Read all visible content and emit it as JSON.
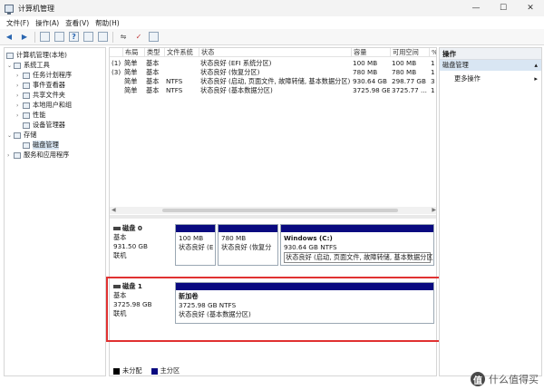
{
  "window": {
    "title": "计算机管理",
    "controls": [
      "—",
      "☐",
      "✕"
    ]
  },
  "menu": [
    "文件(F)",
    "操作(A)",
    "查看(V)",
    "帮助(H)"
  ],
  "tree": {
    "root": "计算机管理(本地)",
    "items": [
      {
        "label": "系统工具",
        "level": 1,
        "expanded": true
      },
      {
        "label": "任务计划程序",
        "level": 2
      },
      {
        "label": "事件查看器",
        "level": 2
      },
      {
        "label": "共享文件夹",
        "level": 2
      },
      {
        "label": "本地用户和组",
        "level": 2
      },
      {
        "label": "性能",
        "level": 2
      },
      {
        "label": "设备管理器",
        "level": 2
      },
      {
        "label": "存储",
        "level": 1,
        "expanded": true
      },
      {
        "label": "磁盘管理",
        "level": 2,
        "selected": true
      },
      {
        "label": "服务和应用程序",
        "level": 1
      }
    ]
  },
  "volumes": {
    "columns": [
      "布局",
      "类型",
      "文件系统",
      "状态",
      "容量",
      "可用空间",
      "%"
    ],
    "rows": [
      {
        "vol": "(1)",
        "layout": "简单",
        "type": "基本",
        "fs": "",
        "status": "状态良好 (EFI 系统分区)",
        "capacity": "100 MB",
        "free": "100 MB",
        "pct": "1"
      },
      {
        "vol": "(3)",
        "layout": "简单",
        "type": "基本",
        "fs": "",
        "status": "状态良好 (恢复分区)",
        "capacity": "780 MB",
        "free": "780 MB",
        "pct": "1"
      },
      {
        "vol": "",
        "layout": "简单",
        "type": "基本",
        "fs": "NTFS",
        "status": "状态良好 (启动, 页面文件, 故障转储, 基本数据分区)",
        "capacity": "930.64 GB",
        "free": "298.77 GB",
        "pct": "3"
      },
      {
        "vol": "",
        "layout": "简单",
        "type": "基本",
        "fs": "NTFS",
        "status": "状态良好 (基本数据分区)",
        "capacity": "3725.98 GB",
        "free": "3725.77 ...",
        "pct": "1"
      }
    ]
  },
  "disks": [
    {
      "name": "磁盘 0",
      "type": "基本",
      "size": "931.50 GB",
      "state": "联机",
      "partitions": [
        {
          "title": "",
          "size": "100 MB",
          "status": "状态良好 (E"
        },
        {
          "title": "",
          "size": "780 MB",
          "status": "状态良好 (恢复分"
        },
        {
          "title": "Windows  (C:)",
          "size": "930.64 GB NTFS",
          "status": "状态良好 (启动, 页面文件, 故障转储, 基本数据分区)"
        }
      ]
    },
    {
      "name": "磁盘 1",
      "type": "基本",
      "size": "3725.98 GB",
      "state": "联机",
      "partitions": [
        {
          "title": "新加卷",
          "size": "3725.98 GB NTFS",
          "status": "状态良好 (基本数据分区)"
        }
      ]
    }
  ],
  "legend": [
    {
      "label": "未分配",
      "color": "#000000"
    },
    {
      "label": "主分区",
      "color": "#0a0a80"
    }
  ],
  "actions": {
    "header": "操作",
    "section": "磁盘管理",
    "more": "更多操作"
  },
  "watermark": {
    "badge": "值",
    "text": "什么值得买"
  },
  "colors": {
    "accent_highlight": "#e03131",
    "partition_bar": "#0a0a80",
    "selection": "#d8e6f3"
  }
}
